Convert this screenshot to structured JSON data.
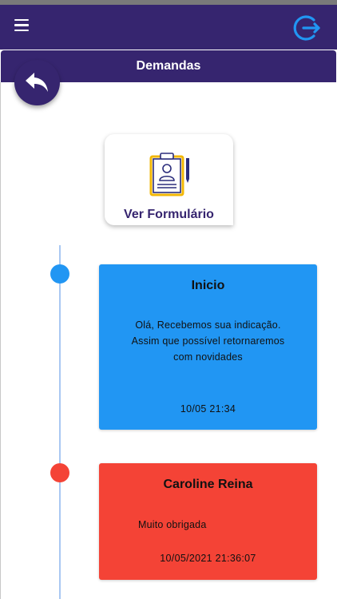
{
  "header": {
    "title": "Demandas",
    "menu_icon": "menu-icon",
    "logout_icon": "logout-icon",
    "back_icon": "reply-arrow-icon"
  },
  "form_card": {
    "label": "Ver Formulário",
    "icon": "clipboard-person-icon"
  },
  "timeline": [
    {
      "title": "Inicio",
      "message": "Olá, Recebemos sua indicação. Assim que possível retornaremos com novidades",
      "timestamp": "10/05 21:34",
      "color": "#2196f3"
    },
    {
      "title": "Caroline Reina",
      "message": "Muito obrigada",
      "timestamp": "10/05/2021 21:36:07",
      "color": "#f44336"
    }
  ],
  "colors": {
    "primary": "#36256f",
    "accent_blue": "#2196f3",
    "accent_red": "#f44336",
    "logout_icon": "#2196f3"
  }
}
